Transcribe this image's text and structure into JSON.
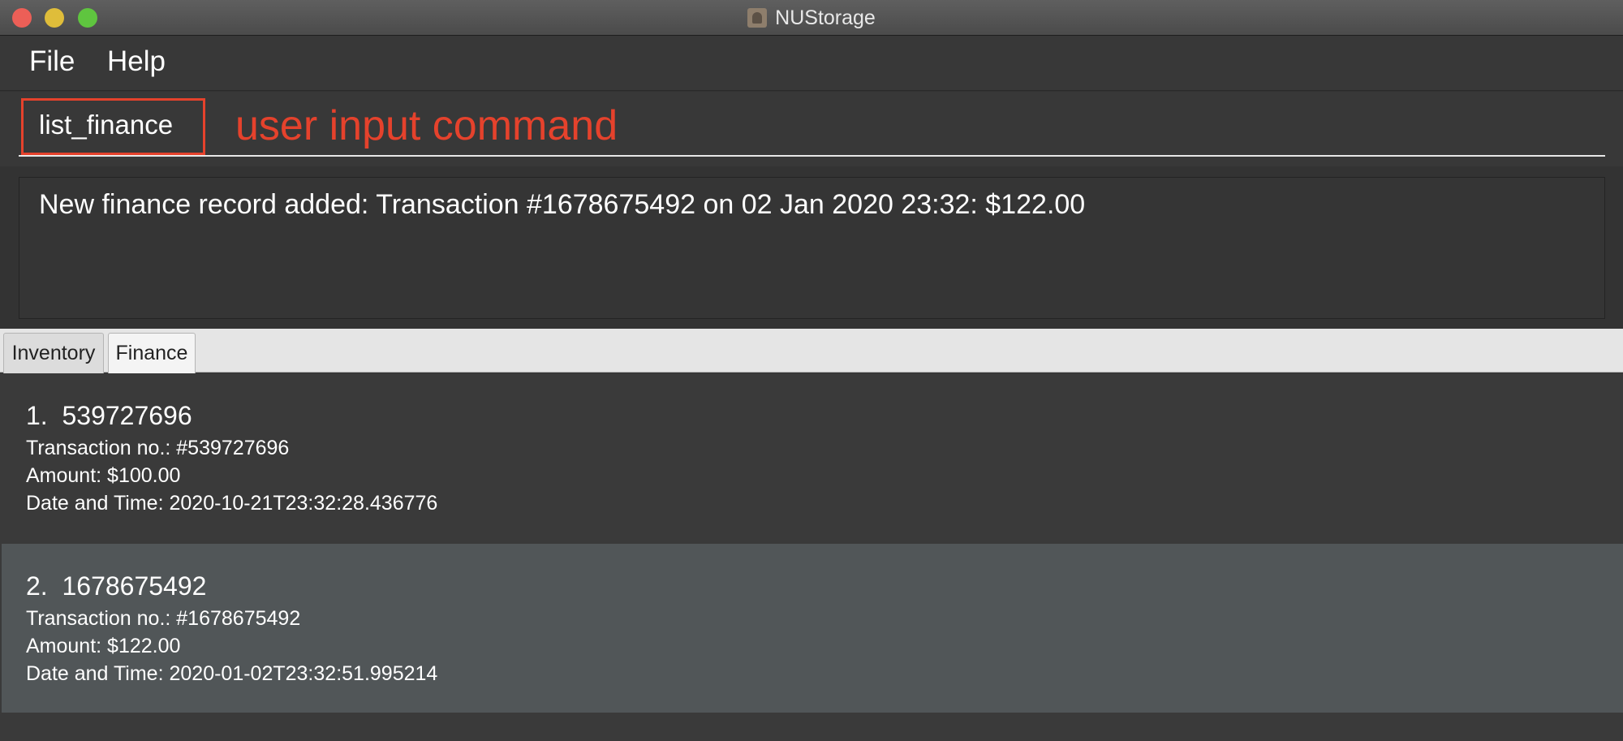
{
  "window": {
    "title": "NUStorage",
    "app_icon": "app-icon"
  },
  "menu": {
    "file": "File",
    "help": "Help"
  },
  "command": {
    "value": "list_finance",
    "annotation": "user input command"
  },
  "result": {
    "message": "New finance record added: Transaction #1678675492 on 02 Jan 2020 23:32: $122.00"
  },
  "tabs": [
    {
      "label": "Inventory",
      "selected": false
    },
    {
      "label": "Finance",
      "selected": true
    }
  ],
  "records": [
    {
      "index": "1.",
      "id": "539727696",
      "transaction": "Transaction no.: #539727696",
      "amount": "Amount: $100.00",
      "datetime": "Date and Time: 2020-10-21T23:32:28.436776"
    },
    {
      "index": "2.",
      "id": "1678675492",
      "transaction": "Transaction no.: #1678675492",
      "amount": "Amount: $122.00",
      "datetime": "Date and Time: 2020-01-02T23:32:51.995214"
    }
  ],
  "colors": {
    "annotation": "#e5422c",
    "background": "#333333",
    "selected_row": "#515658"
  }
}
